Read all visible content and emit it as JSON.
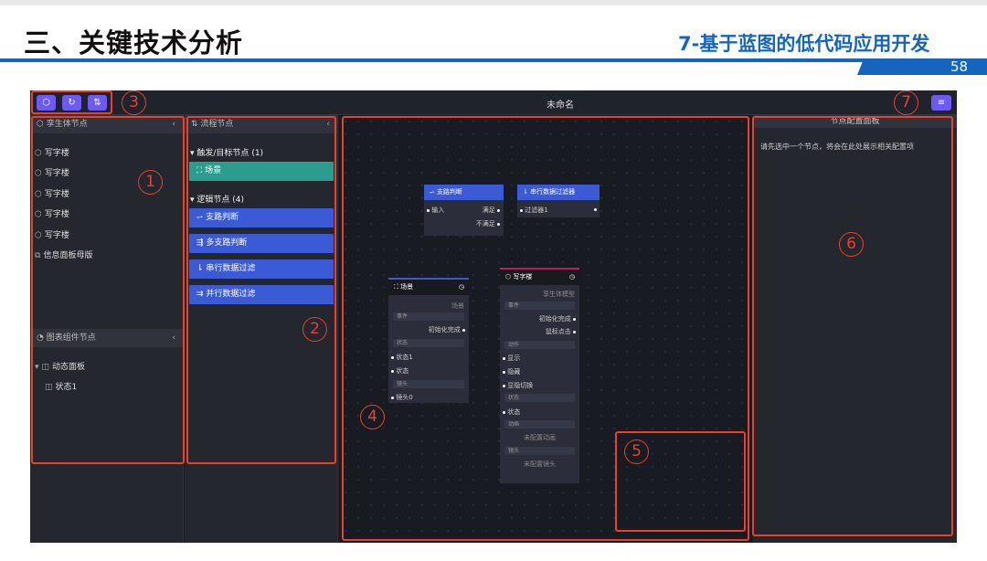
{
  "slide": {
    "title": "三、关键技术分析",
    "subtitle": "7-基于蓝图的低代码应用开发",
    "page_number": "58"
  },
  "app": {
    "window_title": "未命名",
    "toolbar_icons": [
      "cube-icon",
      "refresh-icon",
      "swap-icon"
    ],
    "settings_icon": "menu-icon"
  },
  "twin_panel": {
    "title": "孪生体节点",
    "items": [
      {
        "label": "写字楼",
        "icon": "cube-icon"
      },
      {
        "label": "写字楼",
        "icon": "cube-icon"
      },
      {
        "label": "写字楼",
        "icon": "cube-icon"
      },
      {
        "label": "写字楼",
        "icon": "cube-icon"
      },
      {
        "label": "写字楼",
        "icon": "cube-icon"
      },
      {
        "label": "信息面板母版",
        "icon": "panel-icon"
      }
    ]
  },
  "chart_panel": {
    "title": "图表组件节点",
    "group_label": "动态面板",
    "child_label": "状态1"
  },
  "flow_panel": {
    "title": "流程节点",
    "trigger_cat": "触发/目标节点",
    "trigger_count": "(1)",
    "trigger_item": "场景",
    "logic_cat": "逻辑节点",
    "logic_count": "(4)",
    "logic_items": [
      "支路判断",
      "多支路判断",
      "串行数据过滤",
      "并行数据过滤"
    ]
  },
  "config_panel": {
    "title": "节点配置面板",
    "hint": "请先选中一个节点，将会在此处展示相关配置项"
  },
  "nodes": {
    "branch": {
      "title": "支路判断",
      "input": "输入",
      "yes": "满足",
      "no": "不满足"
    },
    "filter": {
      "title": "串行数据过滤器",
      "filter": "过滤器1"
    },
    "scene": {
      "title": "场景",
      "type": "场景",
      "sec_event": "事件",
      "init_done": "初始化完成",
      "sec_state": "状态",
      "state1": "状态1",
      "state": "状态",
      "sec_cam": "镜头",
      "cam0": "镜头0"
    },
    "office": {
      "title": "写字楼",
      "type": "孪生体模型",
      "sec_event": "事件",
      "init_done": "初始化完成",
      "mouse_click": "鼠标点击",
      "sec_action": "动作",
      "show": "显示",
      "hide": "隐藏",
      "toggle": "显隐切换",
      "sec_state": "状态",
      "state": "状态",
      "sec_anim": "动画",
      "anim_none": "未配置动画",
      "sec_cam": "镜头",
      "cam_none": "未配置镜头"
    }
  },
  "annotations": [
    "1",
    "2",
    "3",
    "4",
    "5",
    "6",
    "7"
  ],
  "colors": {
    "accent": "#6c5bf2",
    "logic": "#3b5bd6",
    "trigger": "#2a9d8f",
    "annotation": "#e8412c",
    "brand": "#1565c0"
  }
}
